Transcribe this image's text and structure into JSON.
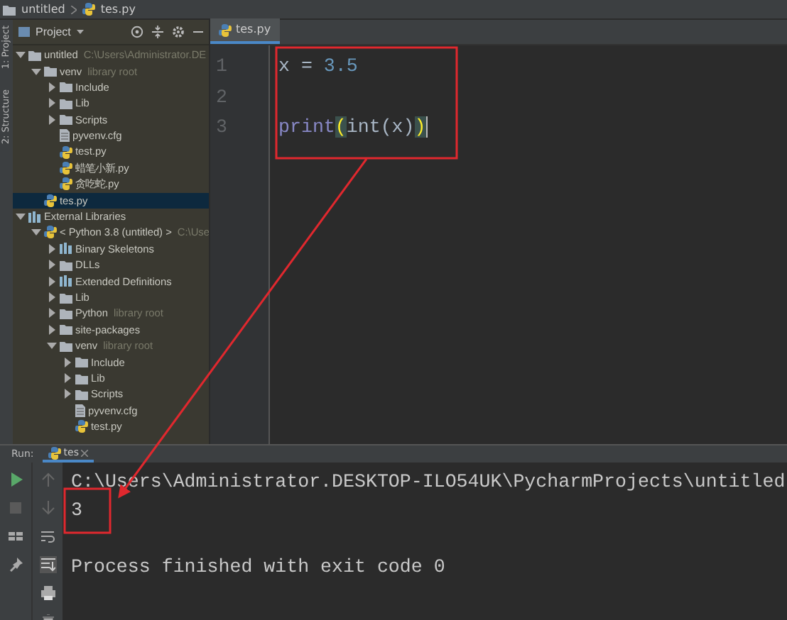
{
  "breadcrumb": [
    {
      "label": "untitled",
      "kind": "folder"
    },
    {
      "label": "tes.py",
      "kind": "python"
    }
  ],
  "tool_strip": [
    "1: Project",
    "2: Structure"
  ],
  "project_panel": {
    "title": "Project",
    "tree": [
      {
        "label": "untitled",
        "hint": "C:\\Users\\Administrator.DE",
        "kind": "folder",
        "expanded": true,
        "selected": false,
        "children": [
          {
            "label": "venv",
            "hint": "library root",
            "kind": "folder",
            "expanded": true,
            "selected": false,
            "children": [
              {
                "label": "Include",
                "kind": "folder",
                "expanded": false,
                "selected": false
              },
              {
                "label": "Lib",
                "kind": "folder",
                "expanded": false,
                "selected": false
              },
              {
                "label": "Scripts",
                "kind": "folder",
                "expanded": false,
                "selected": false
              },
              {
                "label": "pyvenv.cfg",
                "kind": "file",
                "selected": false
              },
              {
                "label": "test.py",
                "kind": "python",
                "selected": false
              },
              {
                "label": "蜡笔小新.py",
                "kind": "python",
                "selected": false
              },
              {
                "label": "贪吃蛇.py",
                "kind": "python",
                "selected": false
              }
            ]
          },
          {
            "label": "tes.py",
            "kind": "python",
            "selected": true
          }
        ]
      },
      {
        "label": "External Libraries",
        "kind": "library",
        "expanded": true,
        "selected": false,
        "children": [
          {
            "label": "< Python 3.8 (untitled) >",
            "hint": "C:\\Use",
            "kind": "python",
            "expanded": true,
            "selected": false,
            "children": [
              {
                "label": "Binary Skeletons",
                "kind": "library",
                "expanded": false,
                "selected": false
              },
              {
                "label": "DLLs",
                "kind": "folder",
                "expanded": false,
                "selected": false
              },
              {
                "label": "Extended Definitions",
                "kind": "library",
                "expanded": false,
                "selected": false
              },
              {
                "label": "Lib",
                "kind": "folder",
                "expanded": false,
                "selected": false
              },
              {
                "label": "Python",
                "hint": "library root",
                "kind": "folder",
                "expanded": false,
                "selected": false
              },
              {
                "label": "site-packages",
                "kind": "folder",
                "expanded": false,
                "selected": false
              },
              {
                "label": "venv",
                "hint": "library root",
                "kind": "folder",
                "expanded": true,
                "selected": false,
                "children": [
                  {
                    "label": "Include",
                    "kind": "folder",
                    "expanded": false,
                    "selected": false
                  },
                  {
                    "label": "Lib",
                    "kind": "folder",
                    "expanded": false,
                    "selected": false
                  },
                  {
                    "label": "Scripts",
                    "kind": "folder",
                    "expanded": false,
                    "selected": false
                  },
                  {
                    "label": "pyvenv.cfg",
                    "kind": "file",
                    "selected": false
                  },
                  {
                    "label": "test.py",
                    "kind": "python",
                    "selected": false
                  }
                ]
              }
            ]
          }
        ]
      }
    ]
  },
  "editor": {
    "tabs": [
      {
        "label": "tes.py",
        "selected": true
      }
    ],
    "lines": [
      {
        "number": "1",
        "tokens": [
          {
            "text": "x = ",
            "kind": "plain"
          },
          {
            "text": "3.5",
            "kind": "number"
          }
        ]
      },
      {
        "number": "2"
      },
      {
        "number": "3",
        "tokens": [
          {
            "text": "print",
            "kind": "builtin"
          },
          {
            "text": "(",
            "kind": "brace"
          },
          {
            "text": "int(x)",
            "kind": "plain"
          },
          {
            "text": ")",
            "kind": "brace"
          }
        ]
      }
    ]
  },
  "run_panel": {
    "title": "Run:",
    "tabs": [
      {
        "label": "tes",
        "selected": true
      }
    ],
    "output": [
      {
        "text": "C:\\Users\\Administrator.DESKTOP-ILO54UK\\PycharmProjects\\untitled",
        "kind": "command"
      },
      {
        "text": "3",
        "kind": "result"
      },
      {
        "text": "Process finished with exit code 0",
        "kind": "status"
      }
    ]
  }
}
